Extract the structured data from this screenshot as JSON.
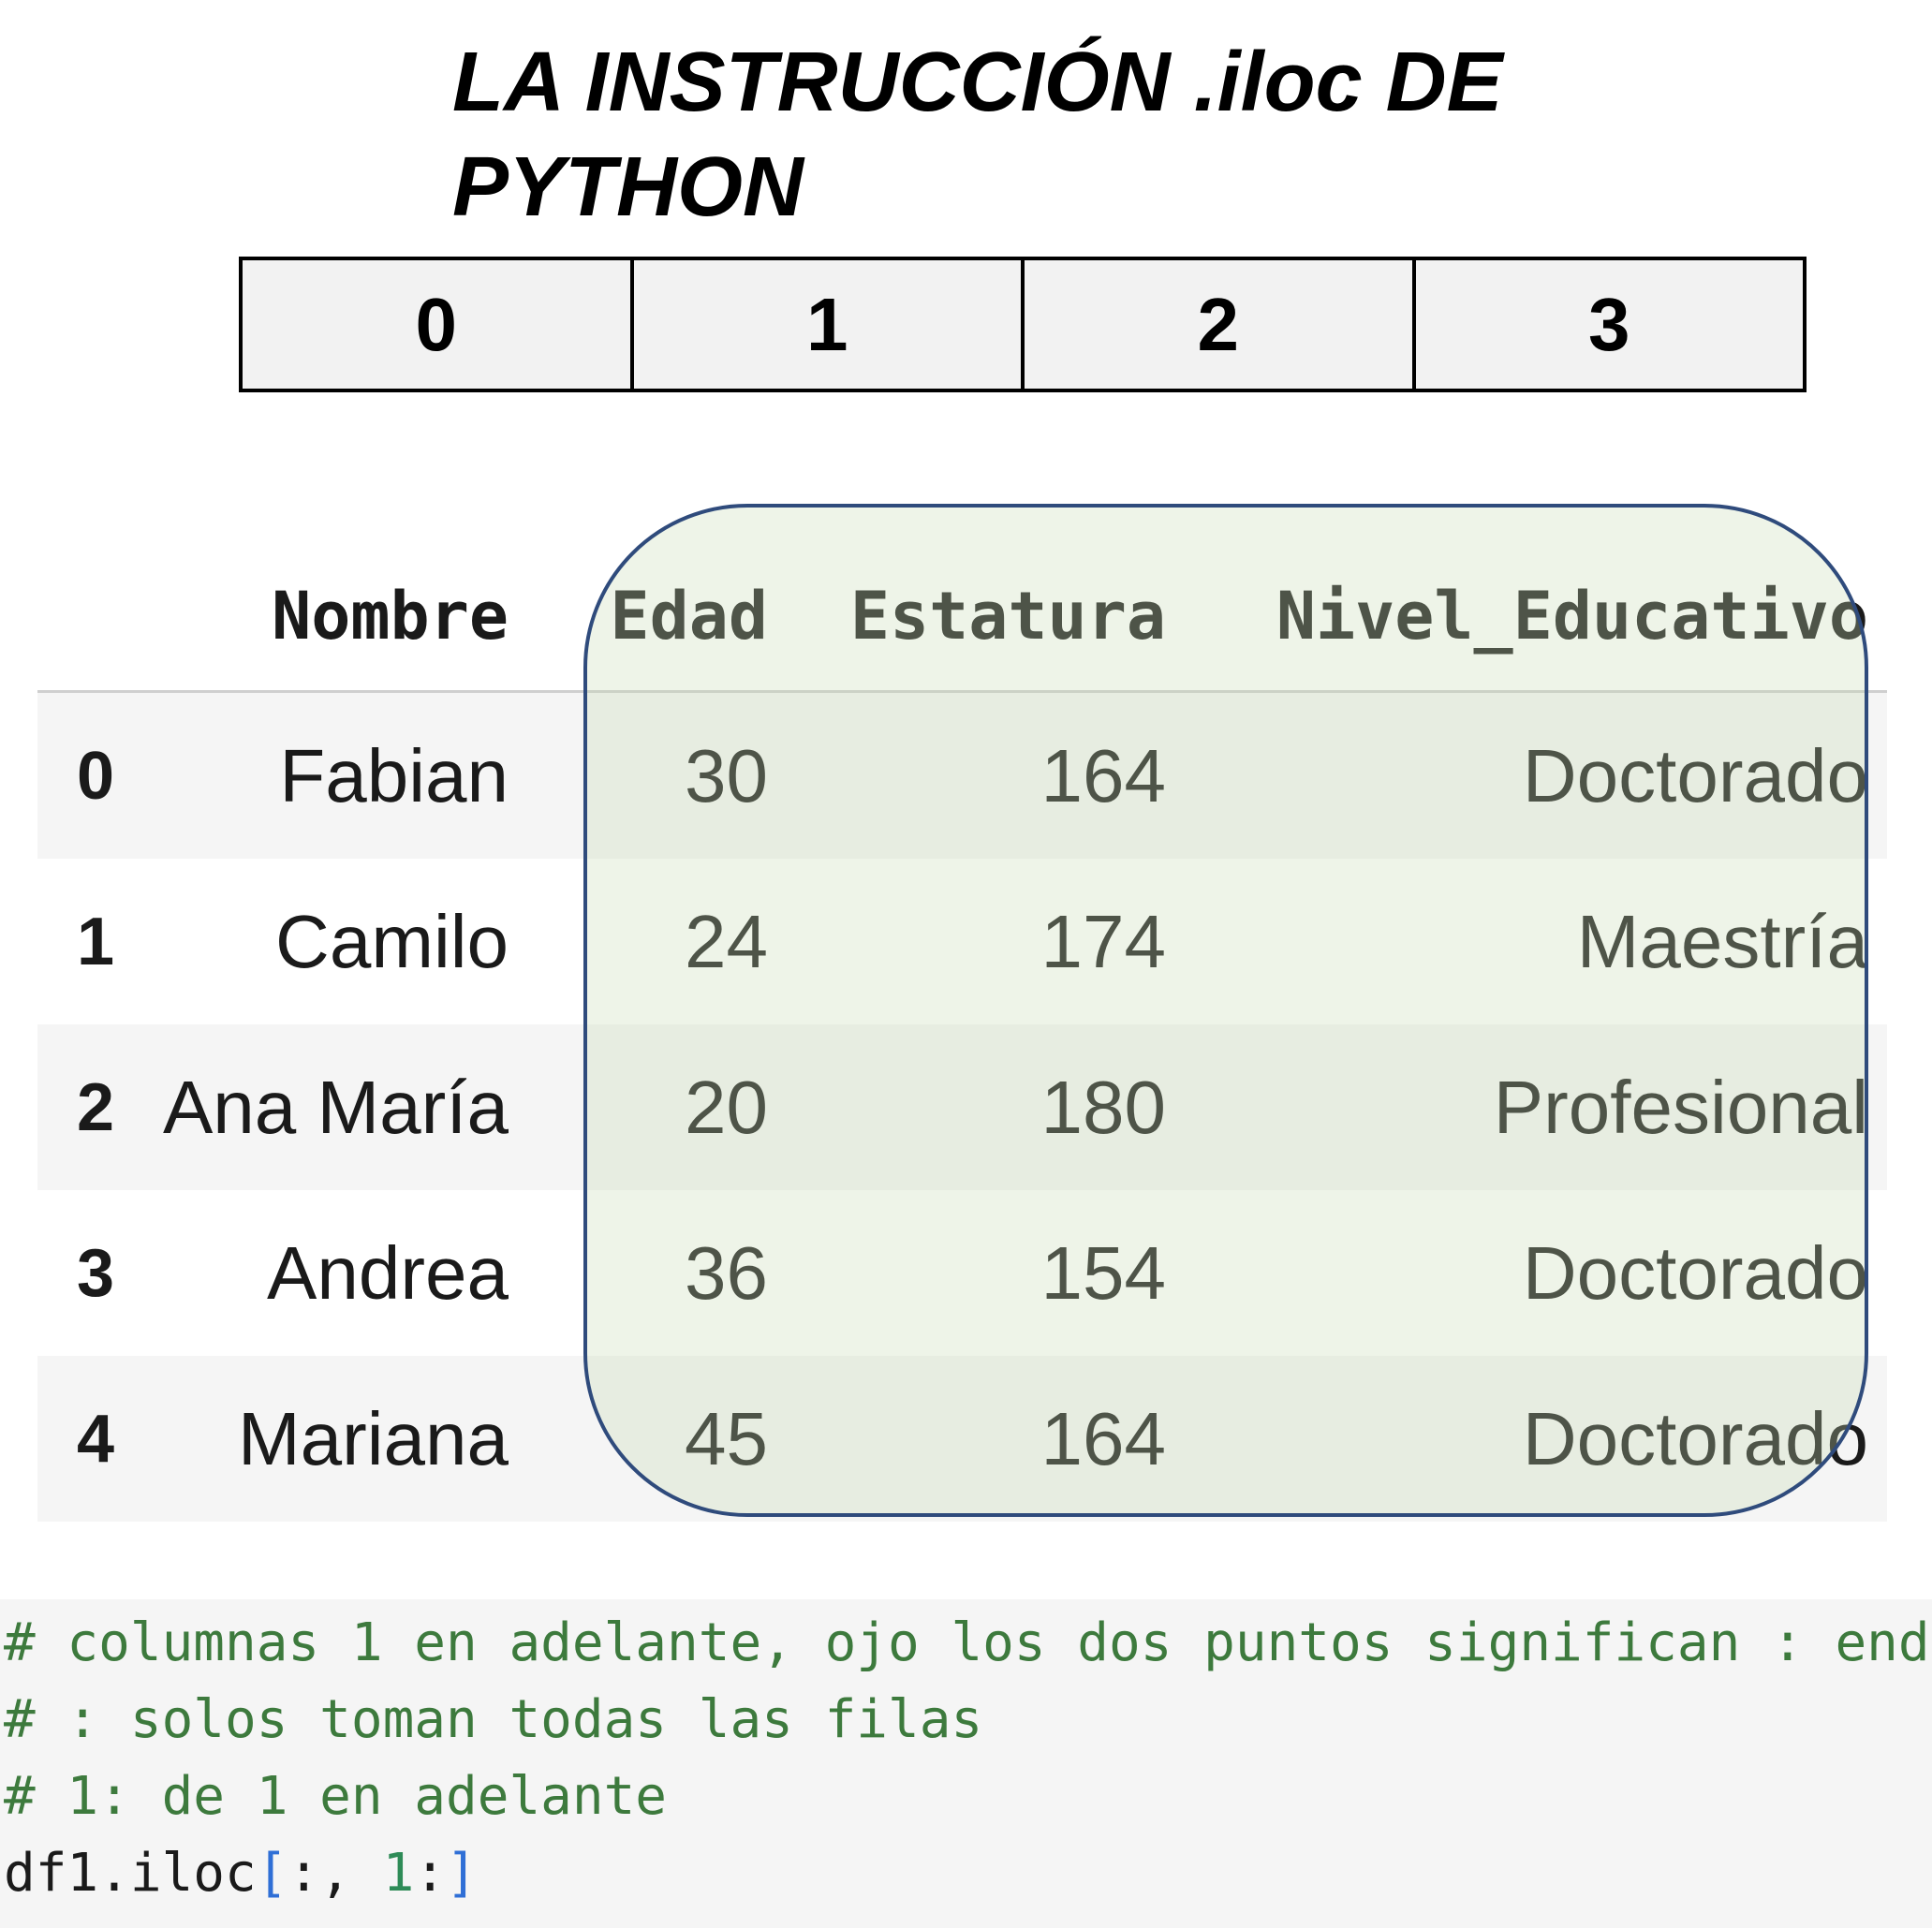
{
  "title": "LA INSTRUCCIÓN .iloc DE PYTHON",
  "position_indices": [
    "0",
    "1",
    "2",
    "3"
  ],
  "dataframe": {
    "columns": [
      "Nombre",
      "Edad",
      "Estatura",
      "Nivel_Educativo"
    ],
    "rows": [
      {
        "index": "0",
        "Nombre": "Fabian",
        "Edad": "30",
        "Estatura": "164",
        "Nivel_Educativo": "Doctorado"
      },
      {
        "index": "1",
        "Nombre": "Camilo",
        "Edad": "24",
        "Estatura": "174",
        "Nivel_Educativo": "Maestría"
      },
      {
        "index": "2",
        "Nombre": "Ana María",
        "Edad": "20",
        "Estatura": "180",
        "Nivel_Educativo": "Profesional"
      },
      {
        "index": "3",
        "Nombre": "Andrea",
        "Edad": "36",
        "Estatura": "154",
        "Nivel_Educativo": "Doctorado"
      },
      {
        "index": "4",
        "Nombre": "Mariana",
        "Edad": "45",
        "Estatura": "164",
        "Nivel_Educativo": "Doctorado"
      }
    ]
  },
  "code": {
    "comment1": "# columnas 1 en adelante, ojo los dos puntos significan : end",
    "comment2": "# : solos toman todas las filas",
    "comment3": "# 1: de 1 en adelante",
    "stmt_prefix": "df1.iloc",
    "stmt_open": "[",
    "stmt_colon": ":, ",
    "stmt_num": "1",
    "stmt_colon2": ":",
    "stmt_close": "]"
  },
  "colors": {
    "highlight_border": "#2f4b7c",
    "highlight_fill": "#dce8cf",
    "comment": "#3d7a3d",
    "bracket": "#2f6fd6"
  }
}
